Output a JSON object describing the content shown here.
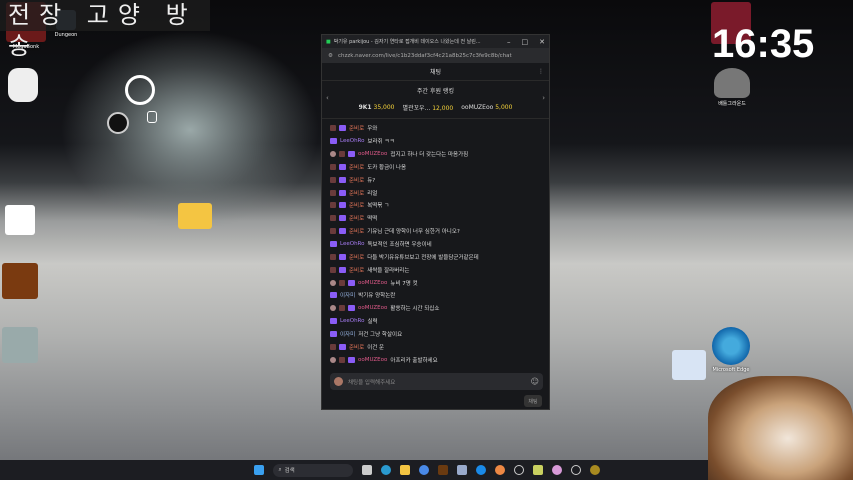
{
  "overlay_title": "전장 고양 방송",
  "clock": "16:35",
  "desktop_icons": [
    {
      "label": "MegaBonk",
      "icon": "megabonk-icon"
    },
    {
      "label": "Dungeon",
      "icon": "game-icon"
    },
    {
      "label": "",
      "icon": "music-app-icon"
    },
    {
      "label": "",
      "icon": "folder-icon"
    },
    {
      "label": "",
      "icon": "app-icon"
    },
    {
      "label": "",
      "icon": "app-icon"
    },
    {
      "label": "",
      "icon": "app-icon"
    },
    {
      "label": "",
      "icon": "game-icon"
    },
    {
      "label": "배틀그라운드",
      "icon": "pubg-icon"
    },
    {
      "label": "Microsoft Edge",
      "icon": "edge-icon"
    }
  ],
  "window": {
    "title": "박기유 parkijou - 김자기 연타로 접개비 데이오스 나왔는데 전 날린...",
    "url": "chzzk.naver.com/live/c1b23ddaf3cf4c21a8b25c7c3fe9c8b/chat",
    "chat_header": "채팅",
    "ranking": {
      "title": "주간 후원 랭킹",
      "entries": [
        {
          "name": "9K1",
          "amount": "35,000"
        },
        {
          "name": "별관꼬우...",
          "amount": "12,000"
        },
        {
          "name": "ooMUZEoo",
          "amount": "5,000"
        }
      ]
    },
    "messages": [
      {
        "user": "준비로",
        "text": "우와",
        "color": "#e8785a"
      },
      {
        "user": "LeeOhRo",
        "text": "보라쥐 ㅋㅋ",
        "color": "#a67cf2"
      },
      {
        "user": "ooMUZEoo",
        "text": "접지고 하나 더 갖는다는 마음가짐",
        "color": "#e05a8a"
      },
      {
        "user": "준비로",
        "text": "도카 황금이 나옴",
        "color": "#e8785a"
      },
      {
        "user": "준비로",
        "text": "듀?",
        "color": "#e8785a"
      },
      {
        "user": "준비로",
        "text": "리얼",
        "color": "#e8785a"
      },
      {
        "user": "준비로",
        "text": "복떡볶 ㄱ",
        "color": "#e8785a"
      },
      {
        "user": "준비로",
        "text": "떡떡",
        "color": "#e8785a"
      },
      {
        "user": "준비로",
        "text": "기유님 근데 양학이 너무 심한거 아니오?",
        "color": "#e8785a"
      },
      {
        "user": "LeeOhRo",
        "text": "독보적인 조심하면 우승이네",
        "color": "#a67cf2"
      },
      {
        "user": "준비로",
        "text": "다들 박기유유튜브보고 전장에 발을담군거같은데",
        "color": "#e8785a"
      },
      {
        "user": "준비로",
        "text": "새싹을 잘라버리는",
        "color": "#e8785a"
      },
      {
        "user": "ooMUZEoo",
        "text": "뉴비 7명 컷",
        "color": "#e05a8a"
      },
      {
        "user": "이자미",
        "text": "박기유 양학논란",
        "color": "#9ab8e8"
      },
      {
        "user": "ooMUZEoo",
        "text": "활쏭하는 시간 되십쇼",
        "color": "#e05a8a"
      },
      {
        "user": "LeeOhRo",
        "text": "실력",
        "color": "#a67cf2"
      },
      {
        "user": "이자미",
        "text": "저건 그냥 학살이요",
        "color": "#9ab8e8"
      },
      {
        "user": "준비로",
        "text": "이건 운",
        "color": "#e8785a"
      },
      {
        "user": "ooMUZEoo",
        "text": "아프리카 출발하세요",
        "color": "#e05a8a"
      }
    ],
    "input_placeholder": "채팅을 입력해주세요",
    "send_label": "채팅"
  },
  "taskbar": {
    "search_label": "검색"
  }
}
